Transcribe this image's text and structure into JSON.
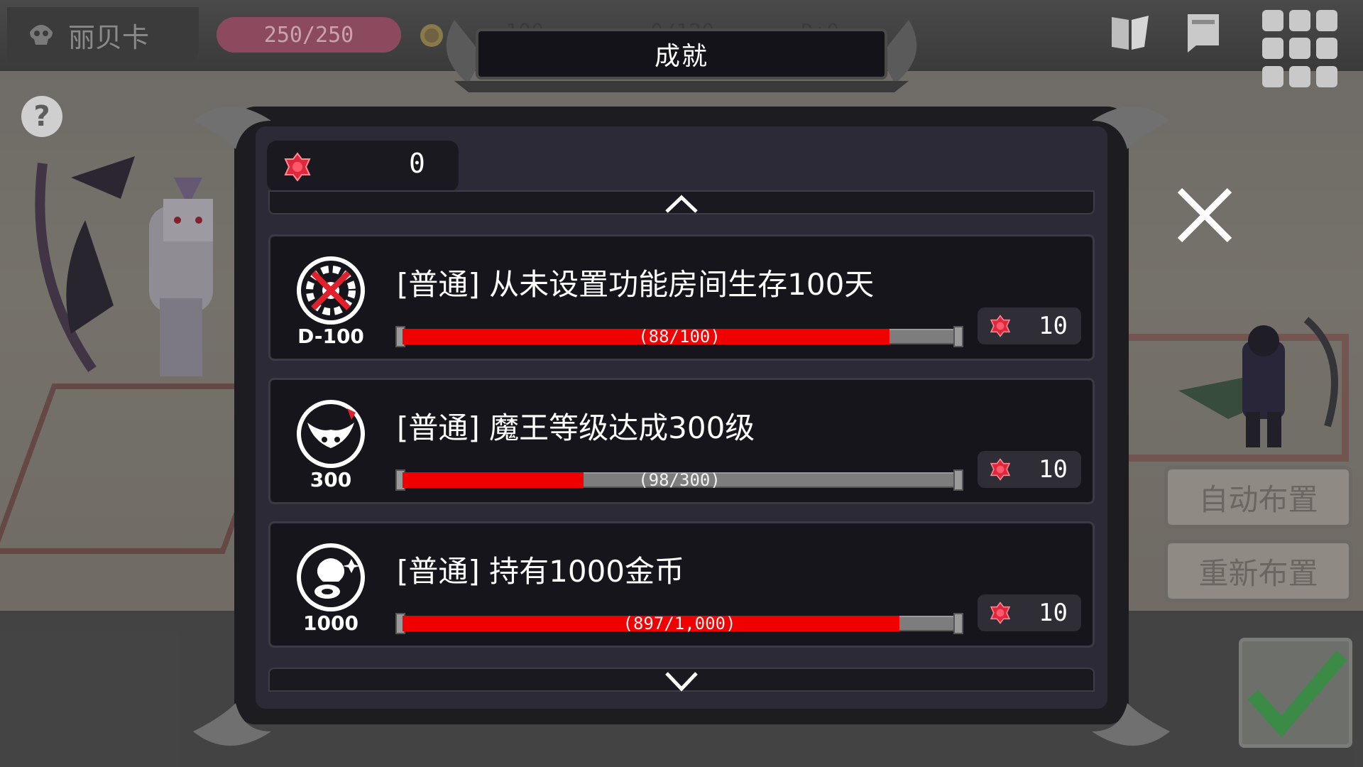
{
  "player": {
    "name": "丽贝卡",
    "hp": "250/250"
  },
  "header": {
    "title": "成就",
    "ghost_values": [
      "100",
      "0/120",
      "D+0"
    ]
  },
  "gems": {
    "count": "0"
  },
  "achievements": [
    {
      "title": "[普通] 从未设置功能房间生存100天",
      "icon_name": "no-gear-icon",
      "icon_label": "D-100",
      "progress_text": "(88/100)",
      "current": 88,
      "target": 100,
      "reward": "10"
    },
    {
      "title": "[普通] 魔王等级达成300级",
      "icon_name": "demon-king-icon",
      "icon_label": "300",
      "progress_text": "(98/300)",
      "current": 98,
      "target": 300,
      "reward": "10"
    },
    {
      "title": "[普通] 持有1000金币",
      "icon_name": "coin-bag-icon",
      "icon_label": "1000",
      "progress_text": "(897/1,000)",
      "current": 897,
      "target": 1000,
      "reward": "10"
    }
  ],
  "side_buttons": {
    "auto_place": "自动布置",
    "reset_place": "重新布置"
  },
  "colors": {
    "progress_fill": "#f00000",
    "gem": "#e0283c",
    "hp_pill": "#8c4a5e",
    "modal_bg": "#2d2a37"
  }
}
